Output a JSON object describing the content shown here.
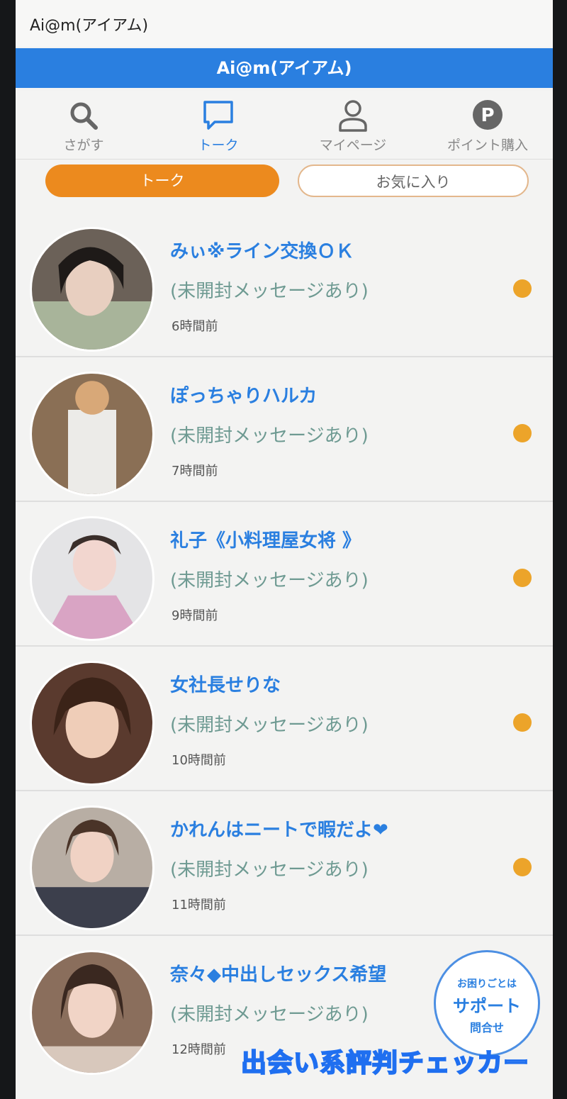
{
  "statusbar": {
    "app_title": "Ai@m(アイアム)"
  },
  "header": {
    "title": "Ai@m(アイアム)"
  },
  "nav": [
    {
      "label": "さがす",
      "icon": "search-icon"
    },
    {
      "label": "トーク",
      "icon": "chat-bubble-icon"
    },
    {
      "label": "マイページ",
      "icon": "user-icon"
    },
    {
      "label": "ポイント購入",
      "icon": "points-p-icon"
    }
  ],
  "tabs": {
    "talk": "トーク",
    "favorites": "お気に入り"
  },
  "conversations": [
    {
      "name": "みぃ※ライン交換ＯＫ",
      "message": "(未開封メッセージあり)",
      "time": "6時間前"
    },
    {
      "name": "ぽっちゃりハルカ",
      "message": "(未開封メッセージあり)",
      "time": "7時間前"
    },
    {
      "name": "礼子《小料理屋女将 》",
      "message": "(未開封メッセージあり)",
      "time": "9時間前"
    },
    {
      "name": "女社長せりな",
      "message": "(未開封メッセージあり)",
      "time": "10時間前"
    },
    {
      "name": "かれんはニートで暇だよ❤",
      "message": "(未開封メッセージあり)",
      "time": "11時間前"
    },
    {
      "name": "奈々◆中出しセックス希望",
      "message": "(未開封メッセージあり)",
      "time": "12時間前"
    }
  ],
  "support": {
    "line1": "お困りごとは",
    "line2": "サポート",
    "line3": "問合せ"
  },
  "watermark": "出会い系評判チェッカー",
  "colors": {
    "accent_blue": "#2a7fe0",
    "accent_orange": "#ec8a1e",
    "unread_dot": "#eca42a"
  }
}
